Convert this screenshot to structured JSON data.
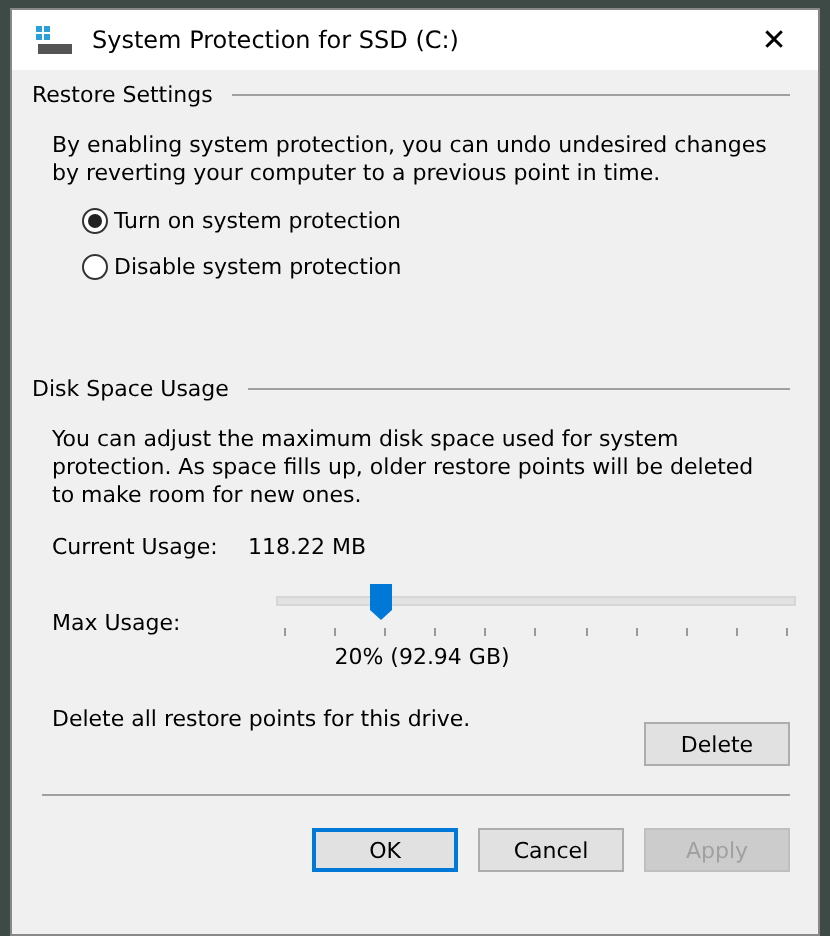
{
  "window": {
    "title": "System Protection for SSD (C:)",
    "close": "✕"
  },
  "restore_settings": {
    "heading": "Restore Settings",
    "description": "By enabling system protection, you can undo undesired changes by reverting your computer to a previous point in time.",
    "options": [
      {
        "label": "Turn on system protection",
        "selected": true
      },
      {
        "label": "Disable system protection",
        "selected": false
      }
    ]
  },
  "disk_space_usage": {
    "heading": "Disk Space Usage",
    "description": "You can adjust the maximum disk space used for system protection. As space fills up, older restore points will be deleted to make room for new ones.",
    "current_usage_label": "Current Usage:",
    "current_usage_value": "118.22 MB",
    "max_usage_label": "Max Usage:",
    "max_usage": {
      "level": 0.2
    },
    "max_usage_reading": "20% (92.94 GB)",
    "delete_text": "Delete all restore points for this drive.",
    "delete_button": "Delete"
  },
  "buttons": [
    {
      "label": "OK",
      "disabled": false,
      "default": true
    },
    {
      "label": "Cancel",
      "disabled": false,
      "default": false
    },
    {
      "label": "Apply",
      "disabled": true,
      "default": false
    }
  ]
}
